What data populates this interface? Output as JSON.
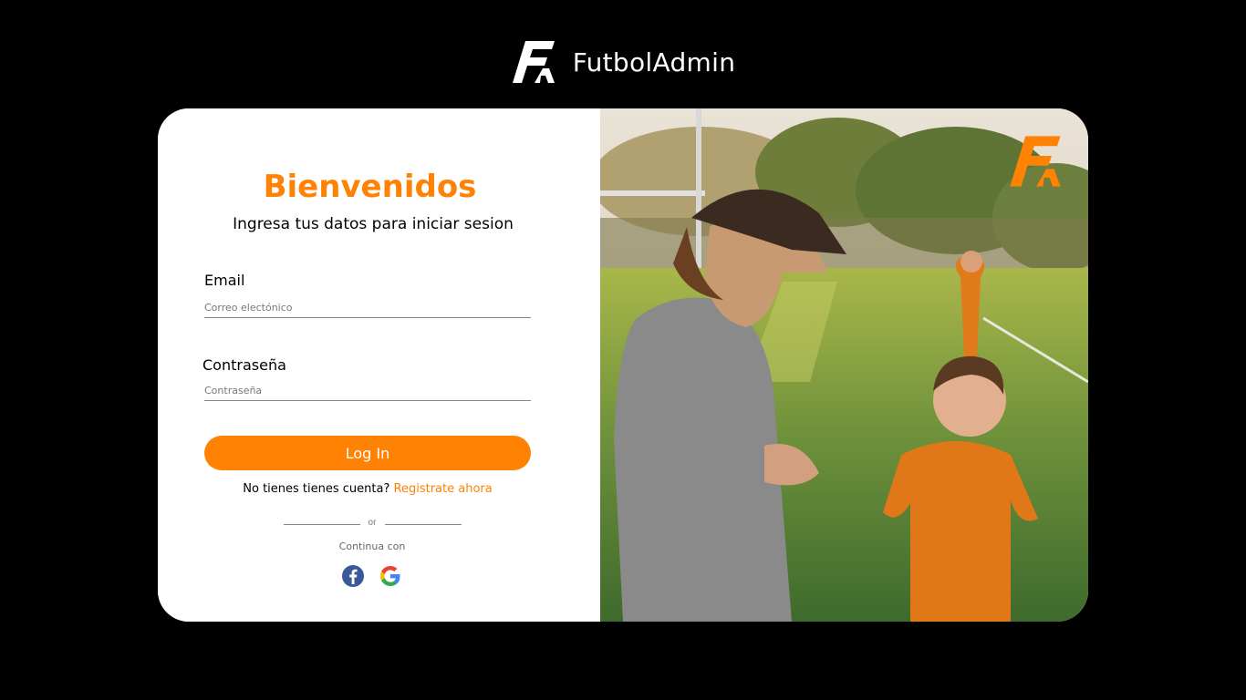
{
  "brand": {
    "name": "FutbolAdmin",
    "logo": "fa-logo-icon"
  },
  "login": {
    "title": "Bienvenidos",
    "subtitle": "Ingresa tus datos para iniciar sesion",
    "email_label": "Email",
    "email_placeholder": "Correo electónico",
    "email_value": "",
    "password_label": "Contraseña",
    "password_placeholder": "Contraseña",
    "password_value": "",
    "login_button": "Log In",
    "no_account_text": "No tienes tienes cuenta?",
    "register_link": "Registrate ahora",
    "or_text": "or",
    "continue_text": "Continua con",
    "social": [
      "facebook-icon",
      "google-icon"
    ]
  },
  "colors": {
    "accent": "#ff8205",
    "background": "#000000",
    "card": "#ffffff"
  },
  "hero_image": {
    "logo": "fa-logo-icon"
  }
}
